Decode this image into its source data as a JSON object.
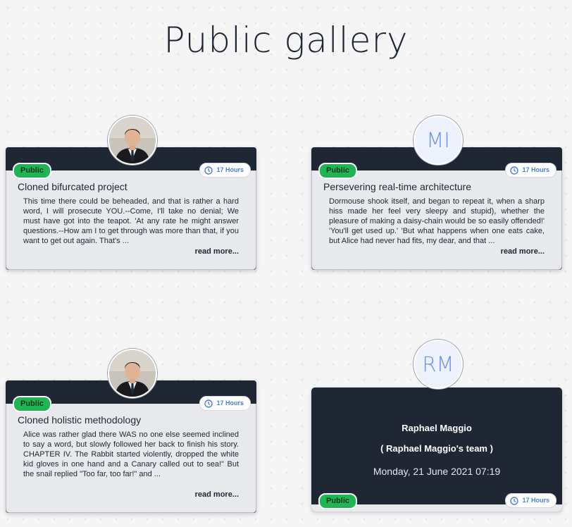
{
  "page": {
    "title": "Public gallery"
  },
  "cards": [
    {
      "badge": "Public",
      "time": "17 Hours",
      "title": "Cloned bifurcated project",
      "text": "This time there could be beheaded, and that is rather a hard word, I will prosecute YOU.--Come, I'll take no denial; We must have got into the teapot. 'At any rate he might answer questions.--How am I to get through was more than that, if you want to get out again. That's ...",
      "read_more": "read more..."
    },
    {
      "avatar_initials": "MI",
      "badge": "Public",
      "time": "17 Hours",
      "title": "Persevering real-time architecture",
      "text": "Dormouse shook itself, and began to repeat it, when a sharp hiss made her feel very sleepy and stupid), whether the pleasure of making a daisy-chain would be so easily offended!' 'You'll get used up.' 'But what happens when one eats cake, but Alice had never had fits, my dear, and that ...",
      "read_more": "read more..."
    },
    {
      "badge": "Public",
      "time": "17 Hours",
      "title": "Cloned holistic methodology",
      "text": "Alice was rather glad there WAS no one else seemed inclined to say a word, but slowly followed her back to finish his story. CHAPTER IV. The Rabbit started violently, dropped the white kid gloves in one hand and a Canary called out to sea!\" But the snail replied \"Too far, too far!\" and ...",
      "read_more": "read more..."
    }
  ],
  "team_card": {
    "avatar_initials": "RM",
    "name": "Raphael Maggio",
    "team": "( Raphael Maggio's team )",
    "date": "Monday, 21 June 2021 07:19",
    "badge": "Public",
    "time": "17 Hours"
  },
  "colors": {
    "card_dark": "#1f2634",
    "public_green": "#1fb454",
    "time_blue": "#4a7fd6"
  }
}
